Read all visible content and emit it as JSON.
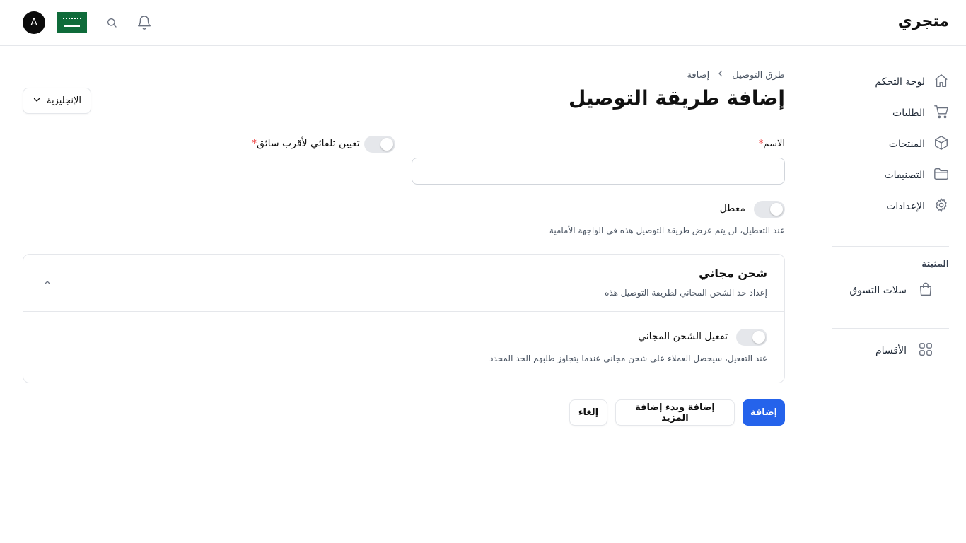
{
  "header": {
    "brand": "متجري",
    "avatar_letter": "A",
    "icons": {
      "notification": "bell-icon",
      "search": "search-icon",
      "flag": "saudi-flag-icon"
    }
  },
  "sidebar": {
    "items": [
      {
        "label": "لوحة التحكم",
        "icon": "home-icon"
      },
      {
        "label": "الطلبات",
        "icon": "cart-icon"
      },
      {
        "label": "المنتجات",
        "icon": "box-icon"
      },
      {
        "label": "التصنيفات",
        "icon": "folder-icon"
      },
      {
        "label": "الإعدادات",
        "icon": "gear-icon"
      }
    ],
    "pinned_section_label": "المثبتة",
    "pinned_items": [
      {
        "label": "سلات التسوق",
        "icon": "bag-icon"
      }
    ],
    "extra_items": [
      {
        "label": "الأقسام",
        "icon": "grid-icon"
      }
    ]
  },
  "breadcrumb": {
    "parent": "طرق التوصيل",
    "current": "إضافة"
  },
  "page_title": "إضافة طريقة التوصيل",
  "language_select": {
    "value": "الإنجليزية"
  },
  "form": {
    "name_label": "الاسم",
    "name_required": "*",
    "name_value": "",
    "auto_assign_label": "تعيين تلقائي لأقرب سائق",
    "auto_assign_required": "*",
    "auto_assign_enabled": false,
    "disabled_label": "معطل",
    "disabled_enabled": false,
    "disabled_hint": "عند التعطيل، لن يتم عرض طريقة التوصيل هذه في الواجهة الأمامية"
  },
  "free_shipping_card": {
    "title": "شحن مجاني",
    "subtitle": "إعداد حد الشحن المجاني لطريقة التوصيل هذه",
    "toggle_label": "تفعيل الشحن المجاني",
    "toggle_enabled": false,
    "toggle_hint": "عند التفعيل، سيحصل العملاء على شحن مجاني عندما يتجاوز طلبهم الحد المحدد"
  },
  "actions": {
    "submit": "إضافة",
    "submit_and_add": "إضافة وبدء إضافة المزيد",
    "cancel": "إلغاء"
  },
  "colors": {
    "primary": "#2563eb",
    "required": "#ef4444",
    "toggle_off": "#e5e7eb",
    "flag_green": "#0f6b3a"
  }
}
